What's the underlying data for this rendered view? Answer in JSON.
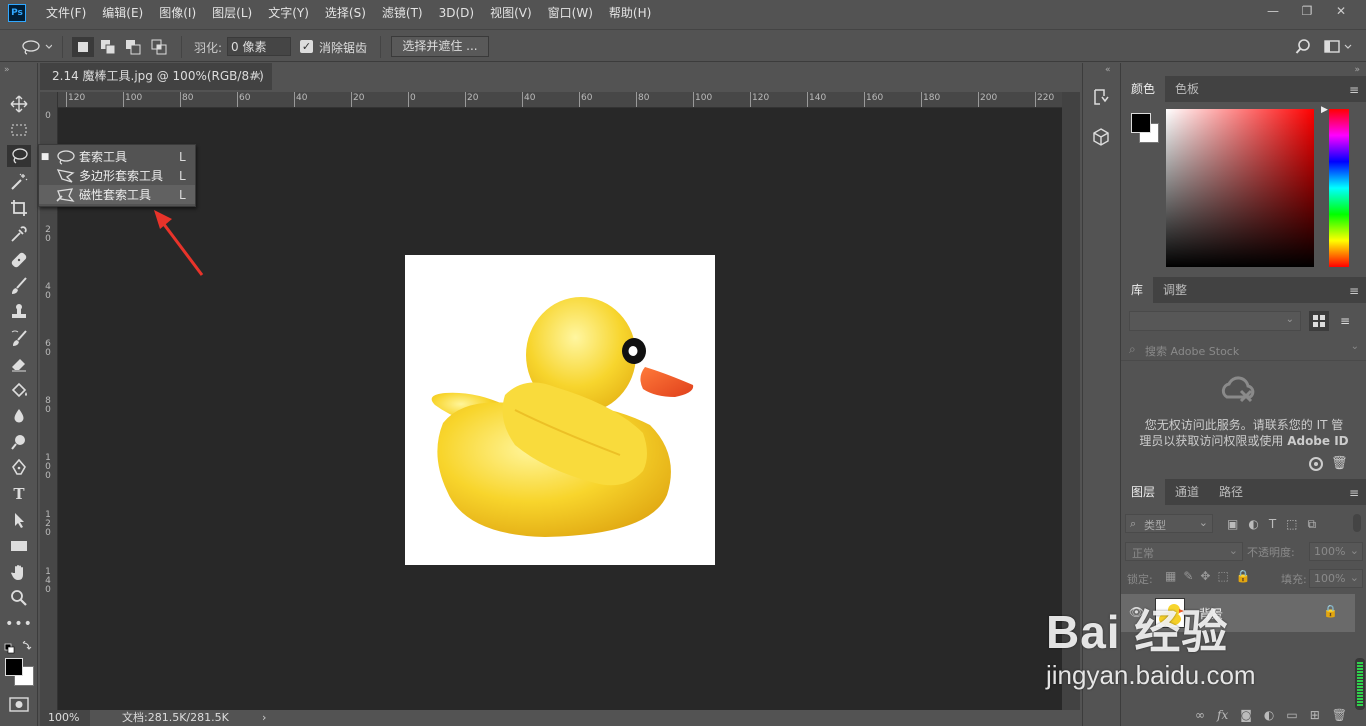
{
  "app": {
    "logo": "Ps"
  },
  "menu": [
    "文件(F)",
    "编辑(E)",
    "图像(I)",
    "图层(L)",
    "文字(Y)",
    "选择(S)",
    "滤镜(T)",
    "3D(D)",
    "视图(V)",
    "窗口(W)",
    "帮助(H)"
  ],
  "window_controls": {
    "minimize": "—",
    "restore": "❐",
    "close": "✕"
  },
  "options": {
    "feather_label": "羽化:",
    "feather_value": "0 像素",
    "antialias_label": "消除锯齿",
    "antialias_checked": true,
    "select_mask_label": "选择并遮住 ..."
  },
  "document": {
    "tab_title": "2.14 魔棒工具.jpg @ 100%(RGB/8#)",
    "tab_close": "×",
    "zoom": "100%",
    "doc_size": "文档:281.5K/281.5K",
    "status_arrow": "›"
  },
  "ruler_h": [
    "120",
    "100",
    "80",
    "60",
    "40",
    "20",
    "0",
    "20",
    "40",
    "60",
    "80",
    "100",
    "120",
    "140",
    "160",
    "180",
    "200",
    "220"
  ],
  "ruler_v": [
    "0",
    "0",
    "2 0",
    "4 0",
    "6 0",
    "8 0",
    "1 0 0",
    "1 2 0",
    "1 4 0"
  ],
  "flyout": {
    "items": [
      {
        "label": "套索工具",
        "key": "L",
        "selected": true,
        "icon": "lasso-icon"
      },
      {
        "label": "多边形套索工具",
        "key": "L",
        "selected": false,
        "icon": "polygonal-lasso-icon"
      },
      {
        "label": "磁性套索工具",
        "key": "L",
        "selected": false,
        "icon": "magnetic-lasso-icon"
      }
    ]
  },
  "panels": {
    "color_tabs": [
      "颜色",
      "色板"
    ],
    "library_tabs": [
      "库",
      "调整"
    ],
    "library_search_placeholder": "搜索 Adobe Stock",
    "library_message_line1": "您无权访问此服务。请联系您的 IT 管",
    "library_message_line2": "理员以获取访问权限或使用 ",
    "library_message_bold": "Adobe ID",
    "layers_tabs": [
      "图层",
      "通道",
      "路径"
    ],
    "layer_filter": "类型",
    "blend_mode": "正常",
    "opacity_label": "不透明度:",
    "opacity_value": "100%",
    "lock_label": "锁定:",
    "fill_label": "填充:",
    "fill_value": "100%",
    "layer_name": "背景",
    "layer_fx": "fx"
  },
  "watermark": {
    "brand_line": "Bai  经验",
    "url": "jingyan.baidu.com"
  },
  "colors": {
    "foreground": "#000000",
    "background": "#ffffff",
    "accent_red": "#e8332a"
  }
}
